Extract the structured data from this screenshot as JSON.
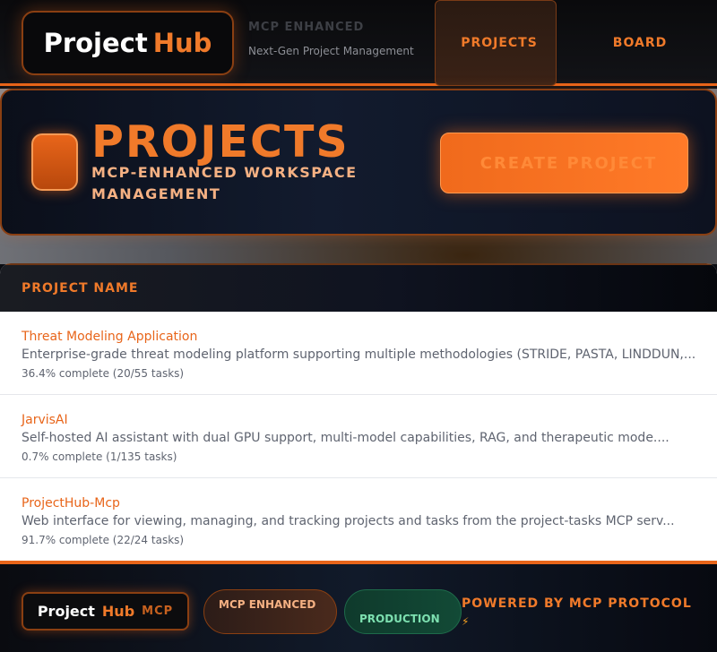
{
  "header": {
    "logo_part1": "Project",
    "logo_part2": "Hub",
    "badge_title": "MCP ENHANCED",
    "badge_subtitle": "Next-Gen Project Management",
    "nav": [
      {
        "label": "PROJECTS",
        "icon": "folder-icon",
        "glyph": ""
      },
      {
        "label": "BOARD",
        "icon": "board-icon",
        "glyph": ""
      }
    ]
  },
  "hero": {
    "icon": "folder-icon",
    "glyph": "",
    "title": "PROJECTS",
    "subtitle": "MCP-ENHANCED WORKSPACE MANAGEMENT",
    "create_button": {
      "label": "CREATE PROJECT",
      "icon": "plus-icon",
      "glyph": ""
    }
  },
  "table": {
    "column_header": "PROJECT NAME",
    "rows": [
      {
        "name": "Threat Modeling Application",
        "description": "Enterprise-grade threat modeling platform supporting multiple methodologies (STRIDE, PASTA, LINDDUN,...",
        "progress": "36.4% complete (20/55 tasks)"
      },
      {
        "name": "JarvisAI",
        "description": "Self-hosted AI assistant with dual GPU support, multi-model capabilities, RAG, and therapeutic mode....",
        "progress": "0.7% complete (1/135 tasks)"
      },
      {
        "name": "ProjectHub-Mcp",
        "description": "Web interface for viewing, managing, and tracking projects and tasks from the project-tasks MCP serv...",
        "progress": "91.7% complete (22/24 tasks)"
      }
    ]
  },
  "footer": {
    "logo_part1": "Project",
    "logo_part2": "Hub",
    "logo_part3": "MCP",
    "pill_mcp": {
      "glyph": "",
      "label": "MCP ENHANCED"
    },
    "pill_production": {
      "glyph": "",
      "label": "PRODUCTION"
    },
    "powered_by": "POWERED BY MCP PROTOCOL",
    "bolt": "⚡"
  },
  "colors": {
    "accent": "#e8651a",
    "accent_light": "#f07a2a",
    "production": "#7de0b0"
  }
}
